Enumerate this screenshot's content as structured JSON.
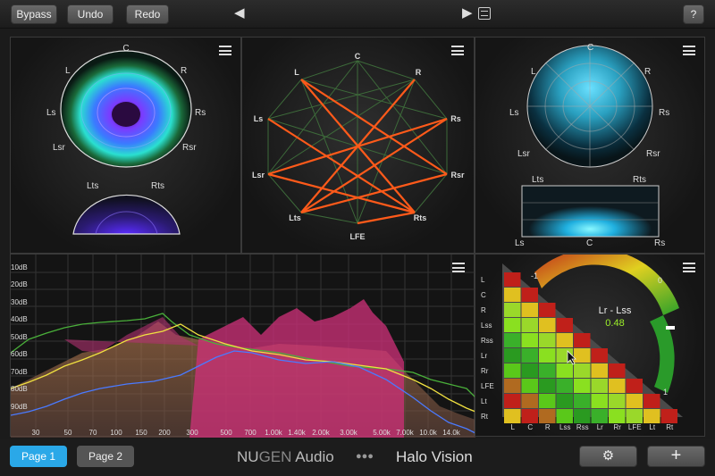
{
  "toolbar": {
    "bypass": "Bypass",
    "undo": "Undo",
    "redo": "Redo",
    "prev_icon": "◀",
    "next_icon": "▶",
    "help": "?"
  },
  "panels": {
    "top_left": {
      "speakers": [
        "C",
        "L",
        "R",
        "Ls",
        "Rs",
        "Lsr",
        "Rsr"
      ],
      "height_speakers": [
        "Lts",
        "Rts"
      ]
    },
    "top_middle": {
      "nodes": [
        "C",
        "R",
        "Rs",
        "Rsr",
        "Rts",
        "LFE",
        "Lts",
        "Lsr",
        "Ls",
        "L"
      ]
    },
    "top_right": {
      "speakers": [
        "C",
        "L",
        "R",
        "Ls",
        "Rs",
        "Lsr",
        "Rsr"
      ],
      "height_top": [
        "Lts",
        "Rts"
      ],
      "height_bottom": [
        "Ls",
        "C",
        "Rs"
      ]
    }
  },
  "spectrum": {
    "y_labels": [
      "10dB",
      "20dB",
      "30dB",
      "40dB",
      "50dB",
      "60dB",
      "70dB",
      "80dB",
      "90dB"
    ],
    "x_labels": [
      "30",
      "50",
      "70",
      "100",
      "150",
      "200",
      "300",
      "500",
      "700",
      "1.00k",
      "1.40k",
      "2.00k",
      "3.00k",
      "5.00k",
      "7.00k",
      "10.0k",
      "14.0k"
    ]
  },
  "correlation": {
    "row_labels": [
      "L",
      "C",
      "R",
      "Lss",
      "Rss",
      "Lr",
      "Rr",
      "LFE",
      "Lt",
      "Rt"
    ],
    "col_labels": [
      "L",
      "C",
      "R",
      "Lss",
      "Rss",
      "Lr",
      "Rr",
      "LFE",
      "Lt",
      "Rt"
    ],
    "scale_min": "-1",
    "scale_mid": "0",
    "scale_max": "1",
    "pair_label": "Lr - Lss",
    "pair_value": "0.48",
    "accent": "#9df02a"
  },
  "footer": {
    "page1": "Page 1",
    "page2": "Page 2",
    "brand_nu": "NU",
    "brand_gen": "GEN",
    "brand_audio": "Audio",
    "dots": "●●●",
    "product": "Halo Vision",
    "settings_icon": "⚙",
    "add_icon": "+"
  }
}
